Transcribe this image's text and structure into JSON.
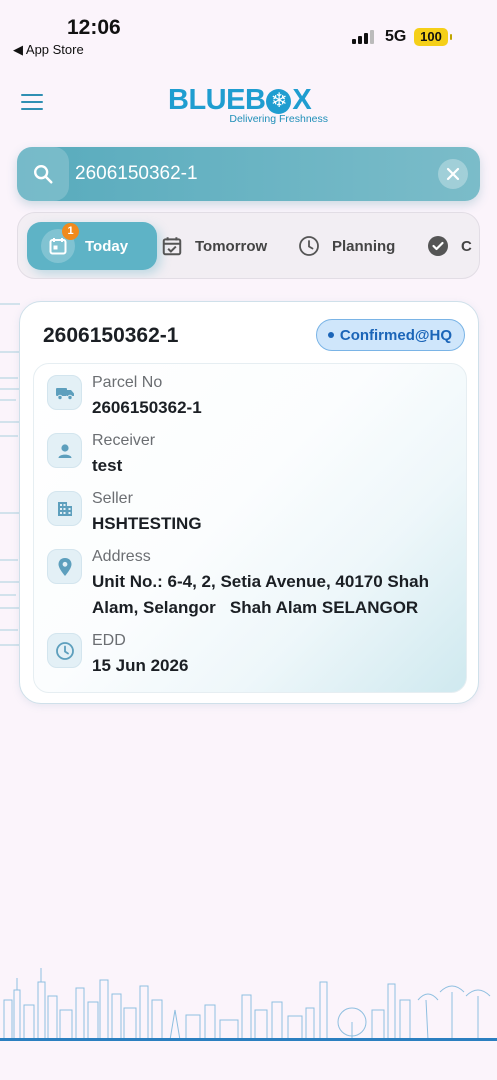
{
  "status_bar": {
    "time": "12:06",
    "back_label": "◀ App Store",
    "network": "5G",
    "battery": "100"
  },
  "header": {
    "menu_icon": "hamburger-icon",
    "logo_left": "BLUEB",
    "logo_right": "X",
    "logo_tagline": "Delivering Freshness",
    "accent_color": "#1f9dd0"
  },
  "search": {
    "value": "2606150362-1",
    "icon": "search-icon",
    "clear_icon": "close-icon"
  },
  "tabs": [
    {
      "label": "Today",
      "icon": "calendar-icon",
      "badge": "1",
      "active": true
    },
    {
      "label": "Tomorrow",
      "icon": "calendar-check-icon",
      "active": false
    },
    {
      "label": "Planning",
      "icon": "clock-icon",
      "active": false
    },
    {
      "label": "C",
      "icon": "check-circle-icon",
      "active": false
    }
  ],
  "parcel": {
    "title": "2606150362-1",
    "status": "Confirmed@HQ",
    "status_color": "#1b65b8",
    "fields": [
      {
        "label": "Parcel No",
        "value": "2606150362-1",
        "icon": "truck-icon"
      },
      {
        "label": "Receiver",
        "value": "test",
        "icon": "person-icon"
      },
      {
        "label": "Seller",
        "value": "HSHTESTING",
        "icon": "building-icon"
      },
      {
        "label": "Address",
        "value_line1": "Unit No.: 6-4, 2, Setia Avenue, 40170 Shah",
        "value_line2": "Alam, Selangor   Shah Alam SELANGOR",
        "icon": "location-pin-icon"
      },
      {
        "label": "EDD",
        "value": "15 Jun 2026",
        "icon": "clock-icon"
      }
    ]
  }
}
